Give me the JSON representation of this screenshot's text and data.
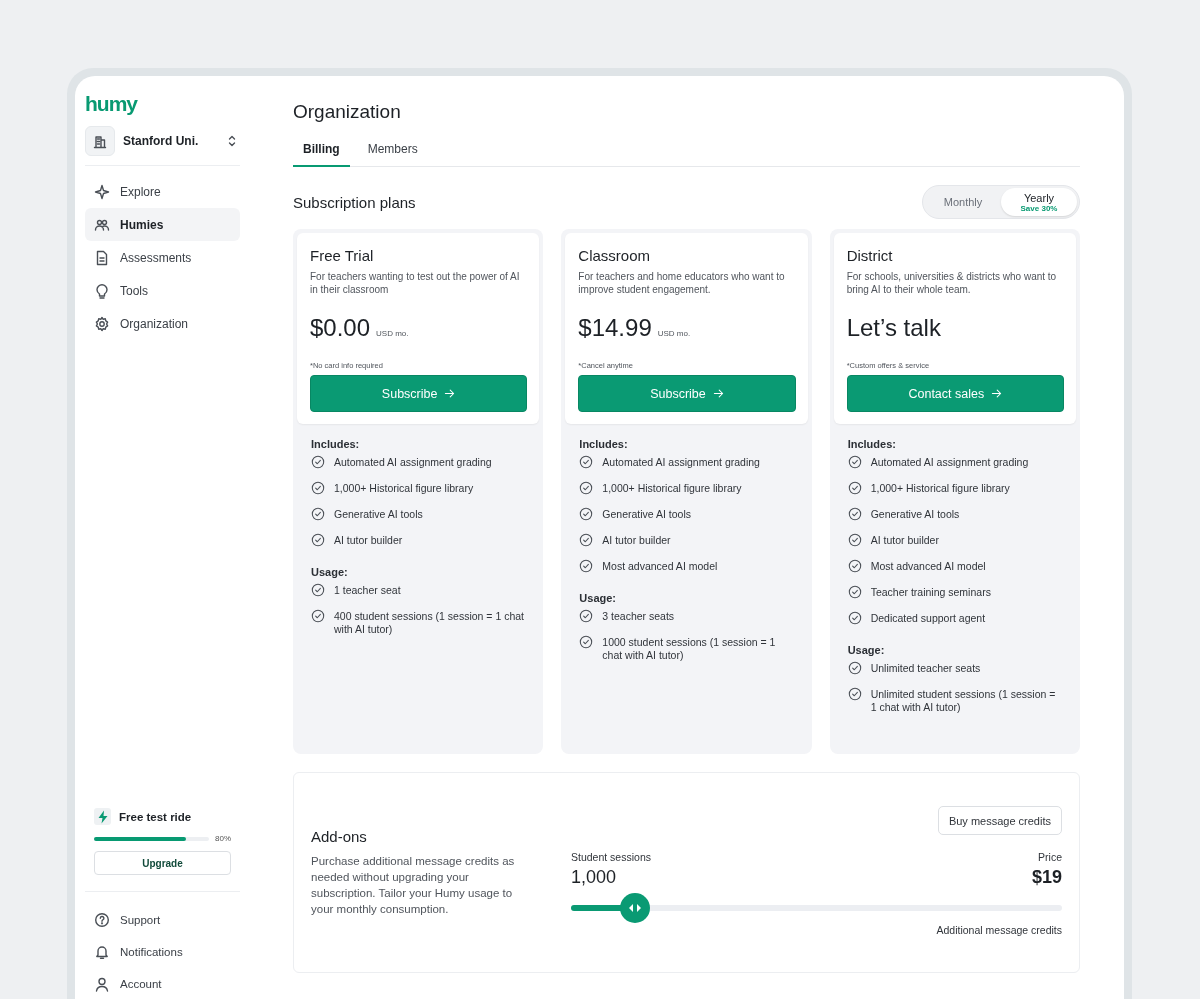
{
  "logo": "humy",
  "org_switcher": {
    "name": "Stanford Uni."
  },
  "nav": [
    {
      "label": "Explore",
      "selected": false
    },
    {
      "label": "Humies",
      "selected": true
    },
    {
      "label": "Assessments",
      "selected": false
    },
    {
      "label": "Tools",
      "selected": false
    },
    {
      "label": "Organization",
      "selected": false
    }
  ],
  "trial": {
    "title": "Free test ride",
    "level": 0.8,
    "percent": "80%",
    "button": "Upgrade"
  },
  "footer_nav": [
    {
      "label": "Support"
    },
    {
      "label": "Notifications"
    },
    {
      "label": "Account"
    }
  ],
  "page": {
    "title": "Organization",
    "tabs": [
      {
        "label": "Billing",
        "selected": true
      },
      {
        "label": "Members",
        "selected": false
      }
    ]
  },
  "plans_section": {
    "title": "Subscription plans",
    "billing_toggle": [
      {
        "label": "Monthly",
        "selected": false
      },
      {
        "label": "Yearly",
        "note": "Save 30%",
        "selected": true
      }
    ]
  },
  "plans": [
    {
      "name": "Free Trial",
      "description": "For teachers wanting to test out the power of AI in their classroom",
      "price": "$0.00",
      "price_unit": "USD mo.",
      "note": "*No card info required",
      "button": "Subscribe",
      "includes_title": "Includes:",
      "includes": [
        "Automated AI assignment grading",
        "1,000+ Historical figure library",
        "Generative AI tools",
        "AI tutor builder"
      ],
      "usage_title": "Usage:",
      "usage": [
        "1 teacher seat",
        "400 student sessions (1 session = 1 chat with AI tutor)"
      ]
    },
    {
      "name": "Classroom",
      "description": "For teachers and home educators who want to improve student engagement.",
      "price": "$14.99",
      "price_unit": "USD mo.",
      "note": "*Cancel anytime",
      "button": "Subscribe",
      "includes_title": "Includes:",
      "includes": [
        "Automated AI assignment grading",
        "1,000+ Historical figure library",
        "Generative AI tools",
        "AI tutor builder",
        "Most advanced AI model"
      ],
      "usage_title": "Usage:",
      "usage": [
        "3 teacher seats",
        "1000 student sessions (1 session = 1 chat with AI tutor)"
      ]
    },
    {
      "name": "District",
      "description": "For schools, universities & districts who want to bring AI to their whole team.",
      "price": "Let’s talk",
      "note": "*Custom offers & service",
      "button": "Contact sales",
      "includes_title": "Includes:",
      "includes": [
        "Automated AI assignment grading",
        "1,000+ Historical figure library",
        "Generative AI tools",
        "AI tutor builder",
        "Most advanced AI model",
        "Teacher training seminars",
        "Dedicated support agent"
      ],
      "usage_title": "Usage:",
      "usage": [
        "Unlimited teacher seats",
        "Unlimited student sessions (1 session = 1 chat with AI tutor)"
      ]
    }
  ],
  "addons": {
    "title": "Add-ons",
    "description": "Purchase additional message credits as needed without upgrading your subscription. Tailor your Humy usage to your monthly consumption.",
    "button": "Buy message credits",
    "sessions_label": "Student sessions",
    "sessions_value": "1,000",
    "price_label": "Price",
    "price_value": "$19",
    "slider": {
      "level": 0.13
    },
    "slider_caption": "Additional message credits"
  }
}
